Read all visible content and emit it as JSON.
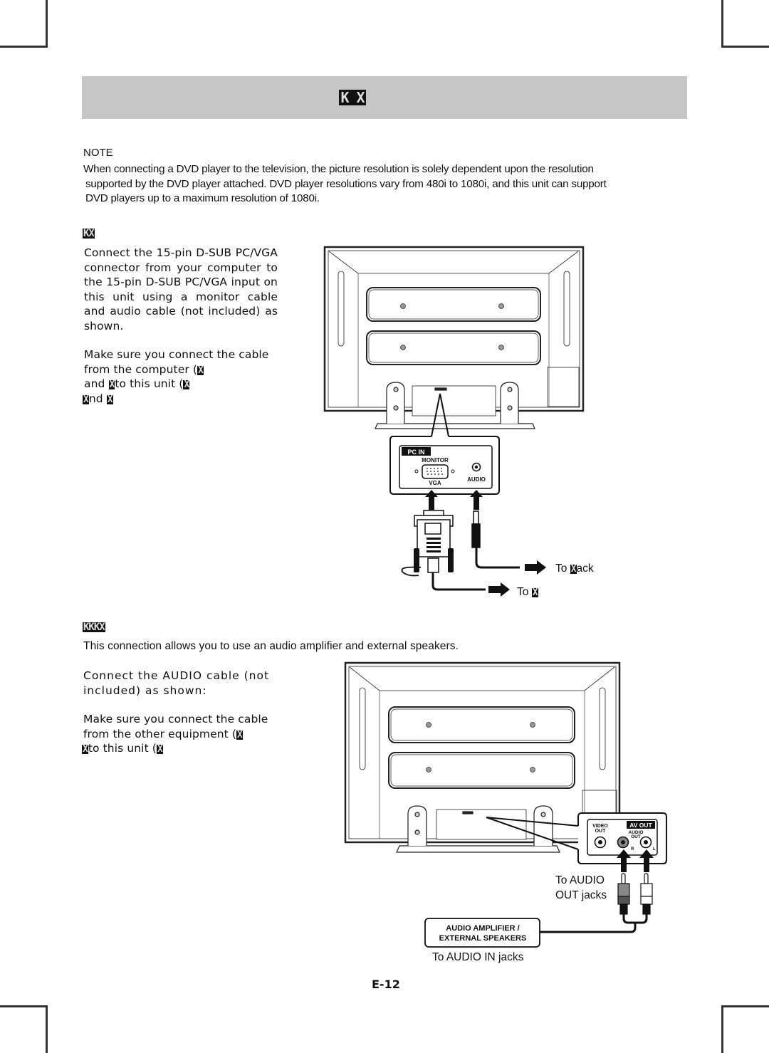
{
  "header": {
    "title_glyphs": "K X"
  },
  "note": {
    "label": "NOTE",
    "lines": [
      "When connecting a DVD player to the television, the picture resolution is solely dependent upon the resolution",
      "supported by the DVD player attached. DVD player resolutions vary from 480i to 1080i, and this unit can support",
      "DVD players up to a maximum resolution of 1080i."
    ]
  },
  "section_pc": {
    "heading_glyphs": "KX",
    "para1": "Connect the 15-pin D-SUB PC/VGA connector from your computer to the 15-pin D-SUB PC/VGA input on this unit using a monitor cable and audio cable (not included) as shown.",
    "para2": {
      "line1": "Make sure you connect the cable",
      "line2a": "from the computer (",
      "line3a": "and ",
      "line3b": "to this unit (",
      "line4b": "nd ",
      "tofu": "X"
    },
    "diagram": {
      "panel_tag": "PC IN",
      "monitor_label": "MONITOR",
      "vga_label": "VGA",
      "audio_label": "AUDIO",
      "to_jack_prefix": "To ",
      "to_jack_suffix": "ack",
      "to_prefix": "To ",
      "tofu": "X"
    }
  },
  "section_audio": {
    "heading_glyphs": "KKKX",
    "intro": "This connection allows you to use an audio amplifier and external speakers.",
    "para1": "Connect the AUDIO cable (not included) as shown:",
    "para2": {
      "line1": "Make sure you connect the cable",
      "line2a": "from the other equipment (",
      "line3a": "to this unit (",
      "tofu": "X"
    },
    "diagram": {
      "video_out_label_1": "VIDEO",
      "video_out_label_2": "OUT",
      "av_out_tag": "AV OUT",
      "audio_out_label_1": "AUDIO",
      "audio_out_label_2": "OUT",
      "r_label": "R",
      "l_label": "L",
      "to_audio_out_1": "To AUDIO",
      "to_audio_out_2": "OUT jacks",
      "device_label_1": "AUDIO AMPLIFIER /",
      "device_label_2": "EXTERNAL SPEAKERS",
      "to_audio_in": "To AUDIO IN jacks"
    }
  },
  "footer": {
    "page_number": "E-12"
  }
}
